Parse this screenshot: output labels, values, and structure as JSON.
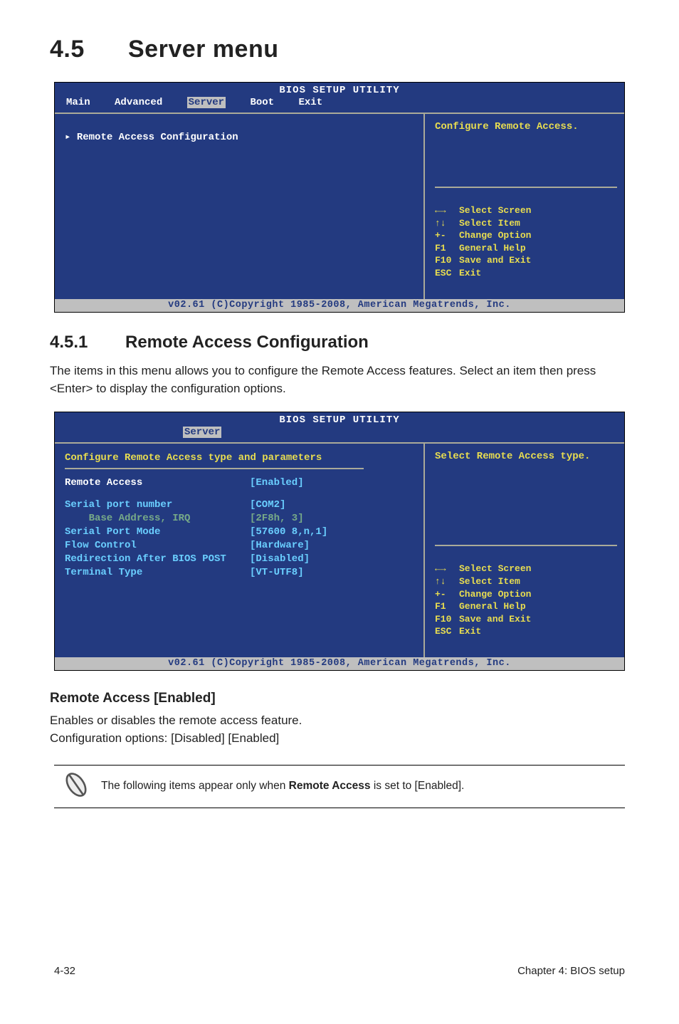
{
  "section": {
    "num": "4.5",
    "title": "Server menu"
  },
  "bios1": {
    "title": "BIOS SETUP UTILITY",
    "menu": {
      "main": "Main",
      "advanced": "Advanced",
      "server": "Server",
      "boot": "Boot",
      "exit": "Exit"
    },
    "left_item": "Remote Access Configuration",
    "help": "Configure Remote Access.",
    "footer": "v02.61 (C)Copyright 1985-2008, American Megatrends, Inc."
  },
  "keys": {
    "l1k": "←→",
    "l1": "Select Screen",
    "l2k": "↑↓",
    "l2": "Select Item",
    "l3k": "+-",
    "l3": "Change Option",
    "l4k": "F1",
    "l4": "General Help",
    "l5k": "F10",
    "l5": "Save and Exit",
    "l6k": "ESC",
    "l6": "Exit"
  },
  "sub451": {
    "num": "4.5.1",
    "title": "Remote Access Configuration"
  },
  "sub451_text": "The items in this menu allows you to configure the Remote Access features. Select an item then press <Enter> to display the configuration options.",
  "bios2": {
    "title": "BIOS SETUP UTILITY",
    "tab": "Server",
    "heading": "Configure Remote Access type and parameters",
    "help": "Select Remote Access type.",
    "rows": {
      "ra_label": "Remote Access",
      "ra_val": "[Enabled]",
      "spn_label": "Serial port number",
      "spn_val": "[COM2]",
      "ba_label": "    Base Address, IRQ",
      "ba_val": "[2F8h, 3]",
      "spm_label": "Serial Port Mode",
      "spm_val": "[57600 8,n,1]",
      "fc_label": "Flow Control",
      "fc_val": "[Hardware]",
      "rb_label": "Redirection After BIOS POST",
      "rb_val": "[Disabled]",
      "tt_label": "Terminal Type",
      "tt_val": "[VT-UTF8]"
    },
    "footer": "v02.61 (C)Copyright 1985-2008, American Megatrends, Inc."
  },
  "opt1": {
    "title": "Remote Access [Enabled]",
    "line1": "Enables or disables the remote access feature.",
    "line2": "Configuration options: [Disabled] [Enabled]"
  },
  "note": {
    "prefix": "The following items appear only when ",
    "bold": "Remote Access",
    "suffix": " is set to [Enabled]."
  },
  "footer": {
    "left": "4-32",
    "right": "Chapter 4: BIOS setup"
  }
}
